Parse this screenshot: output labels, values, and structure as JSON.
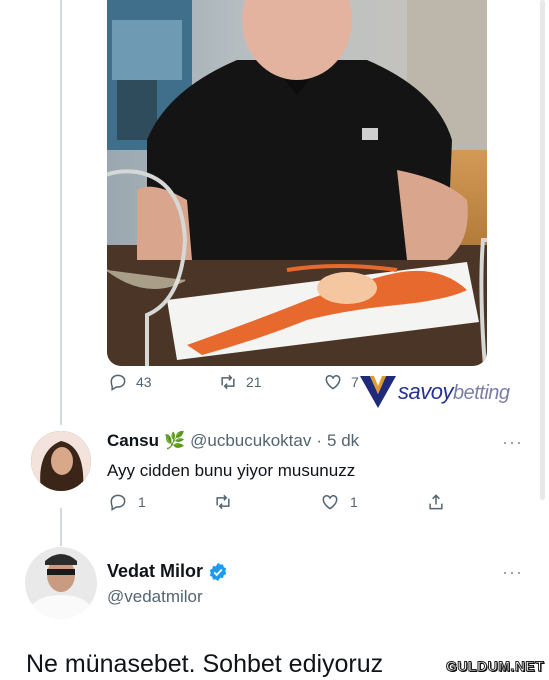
{
  "photo_tweet": {
    "actions": {
      "replies": "43",
      "retweets": "21",
      "likes": "7"
    },
    "watermark": {
      "brand": "savoy",
      "brand_suffix": "betting"
    }
  },
  "reply": {
    "display_name": "Cansu",
    "badge_emoji": "🌿",
    "handle": "@ucbucukoktav",
    "separator": "·",
    "time": "5 dk",
    "text": "Ayy cidden bunu yiyor musunuzz",
    "more": "···",
    "actions": {
      "replies": "1",
      "retweets": "",
      "likes": "1"
    }
  },
  "author": {
    "display_name": "Vedat Milor",
    "handle": "@vedatmilor",
    "more": "···",
    "verified": true
  },
  "answer_text": "Ne münasebet. Sohbet ediyoruz",
  "site_watermark": "GULDUM.NET",
  "colors": {
    "verified": "#1d9bf0",
    "muted": "#536471",
    "line": "#cfd9de"
  }
}
